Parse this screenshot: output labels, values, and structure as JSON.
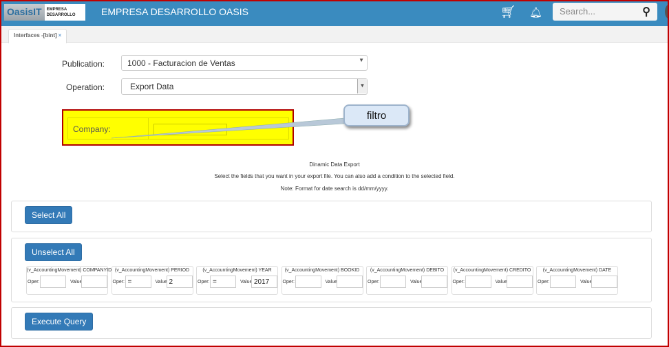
{
  "header": {
    "logo_main": "OasisIT",
    "logo_sub": "EMPRESA DESARROLLO",
    "title": "EMPRESA DESARROLLO OASIS",
    "search_placeholder": "Search...",
    "icons": [
      "cart-icon",
      "bell-icon",
      "search-icon"
    ],
    "color": "#3a8bbf"
  },
  "tabs": [
    {
      "label": "Interfaces -[bint]",
      "close": "×"
    }
  ],
  "form": {
    "publication_label": "Publication:",
    "publication_value": "1000 - Facturacion de Ventas",
    "operation_label": "Operation:",
    "operation_value": "Export Data",
    "company_label": "Company:",
    "company_value": ""
  },
  "callout": {
    "text": "filtro"
  },
  "notes": {
    "title": "Dinamic Data Export",
    "line1": "Select the fields that you want in your export file. You can also add a condition to the selected field.",
    "line2": "Note: Format for date search is dd/mm/yyyy."
  },
  "buttons": {
    "select_all": "Select All",
    "unselect_all": "Unselect All",
    "execute": "Execute Query"
  },
  "field_labels": {
    "oper": "Oper:",
    "value": "Value:"
  },
  "fields": [
    {
      "title": "(v_AccountingMovement) COMPANYID",
      "oper": "",
      "value": ""
    },
    {
      "title": "(v_AccountingMovement) PERIOD",
      "oper": "=",
      "value": "2"
    },
    {
      "title": "(v_AccountingMovement) YEAR",
      "oper": "=",
      "value": "2017"
    },
    {
      "title": "(v_AccountingMovement) BOOKID",
      "oper": "",
      "value": ""
    },
    {
      "title": "(v_AccountingMovement) DEBITO",
      "oper": "",
      "value": ""
    },
    {
      "title": "(v_AccountingMovement) CREDITO",
      "oper": "",
      "value": ""
    },
    {
      "title": "(v_AccountingMovement) DATE",
      "oper": "",
      "value": ""
    }
  ]
}
